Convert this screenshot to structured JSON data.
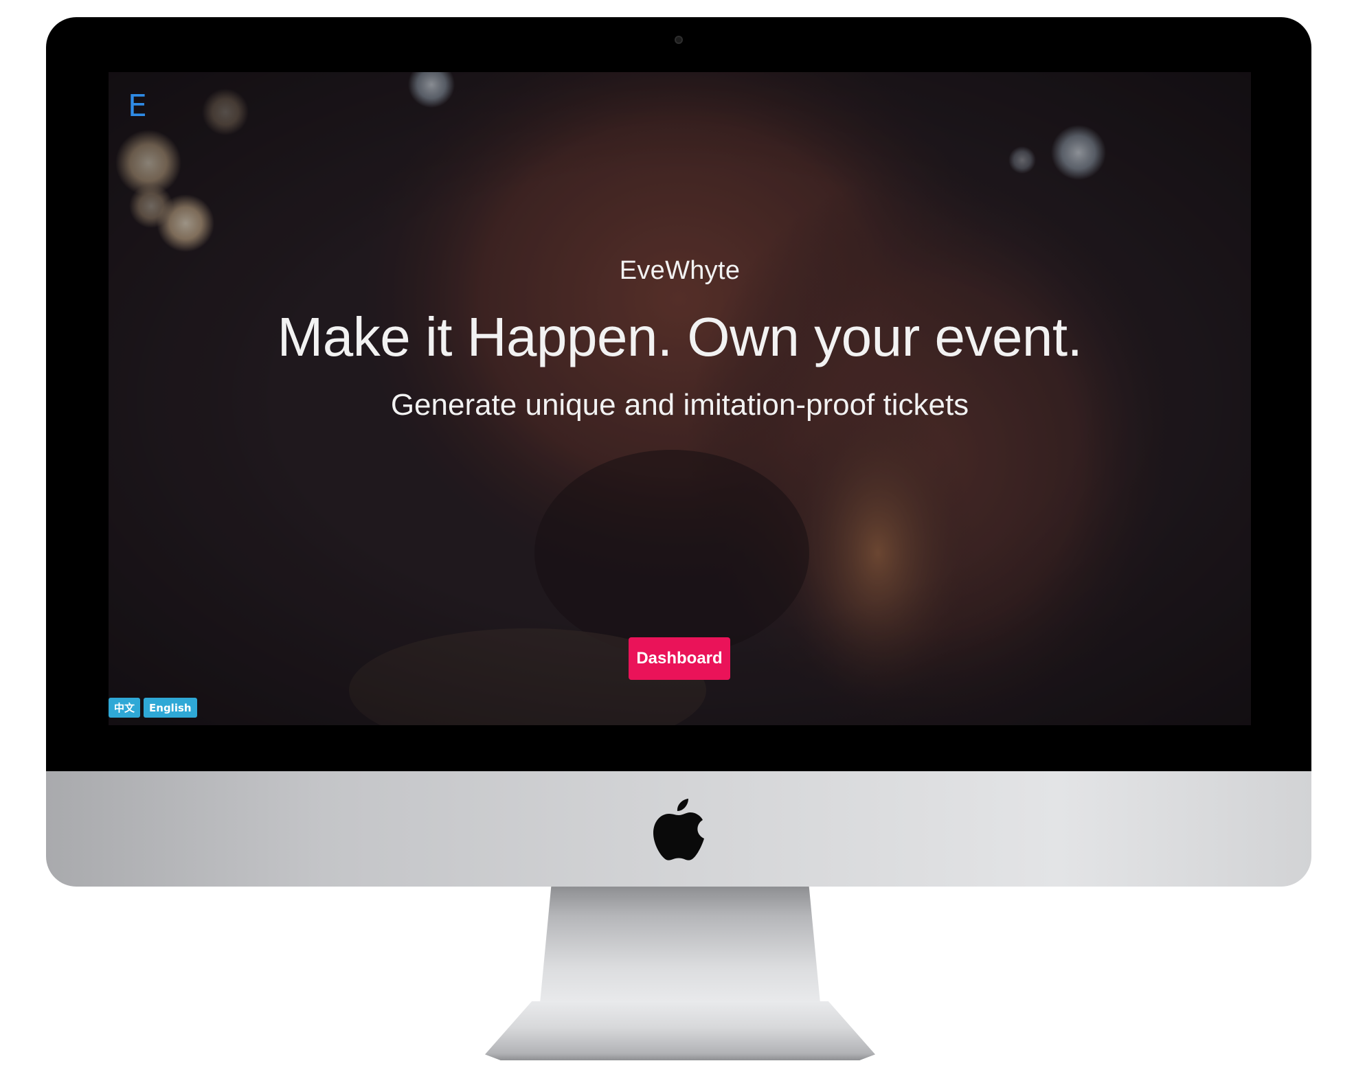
{
  "site": {
    "logo_letter": "E",
    "brand_name": "EveWhyte",
    "headline": "Make it Happen. Own your event.",
    "tagline": "Generate unique and imitation-proof tickets"
  },
  "cta": {
    "dashboard_label": "Dashboard",
    "color": "#ea1359"
  },
  "language_switcher": {
    "options": [
      "中文",
      "English"
    ],
    "color": "#2fa8d6"
  },
  "device": {
    "type": "desktop-monitor",
    "logo_icon": "apple-icon"
  },
  "colors": {
    "logo": "#2f8be6",
    "text": "#f2f2f2"
  }
}
